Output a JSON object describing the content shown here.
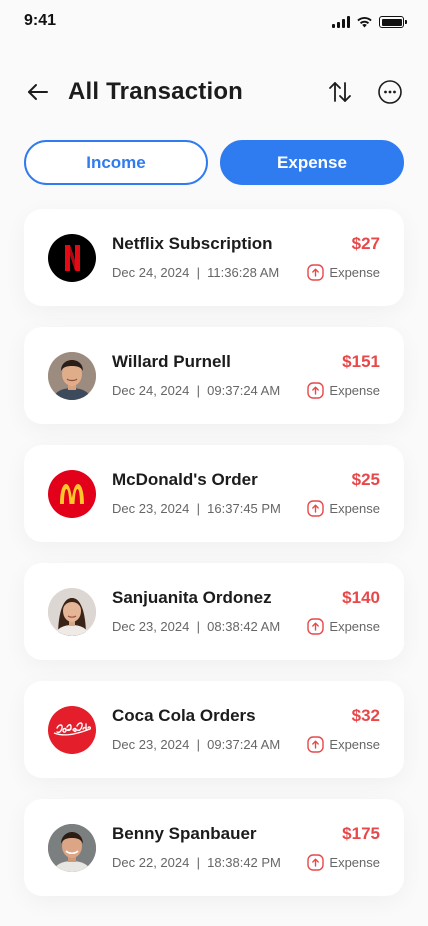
{
  "status_bar": {
    "time": "9:41"
  },
  "header": {
    "title": "All Transaction"
  },
  "tabs": [
    {
      "label": "Income"
    },
    {
      "label": "Expense"
    }
  ],
  "colors": {
    "accent": "#2f7bf0",
    "expense": "#e8484a"
  },
  "transactions": [
    {
      "name": "Netflix Subscription",
      "amount": "$27",
      "date": "Dec 24, 2024",
      "time": "11:36:28 AM",
      "type": "Expense",
      "avatar": "netflix-logo"
    },
    {
      "name": "Willard Purnell",
      "amount": "$151",
      "date": "Dec 24, 2024",
      "time": "09:37:24 AM",
      "type": "Expense",
      "avatar": "person-photo"
    },
    {
      "name": "McDonald's Order",
      "amount": "$25",
      "date": "Dec 23, 2024",
      "time": "16:37:45 PM",
      "type": "Expense",
      "avatar": "mcdonalds-logo"
    },
    {
      "name": "Sanjuanita Ordonez",
      "amount": "$140",
      "date": "Dec 23, 2024",
      "time": "08:38:42 AM",
      "type": "Expense",
      "avatar": "person-photo"
    },
    {
      "name": "Coca Cola Orders",
      "amount": "$32",
      "date": "Dec 23, 2024",
      "time": "09:37:24 AM",
      "type": "Expense",
      "avatar": "coca-cola-logo"
    },
    {
      "name": "Benny Spanbauer",
      "amount": "$175",
      "date": "Dec 22, 2024",
      "time": "18:38:42 PM",
      "type": "Expense",
      "avatar": "person-photo"
    }
  ]
}
